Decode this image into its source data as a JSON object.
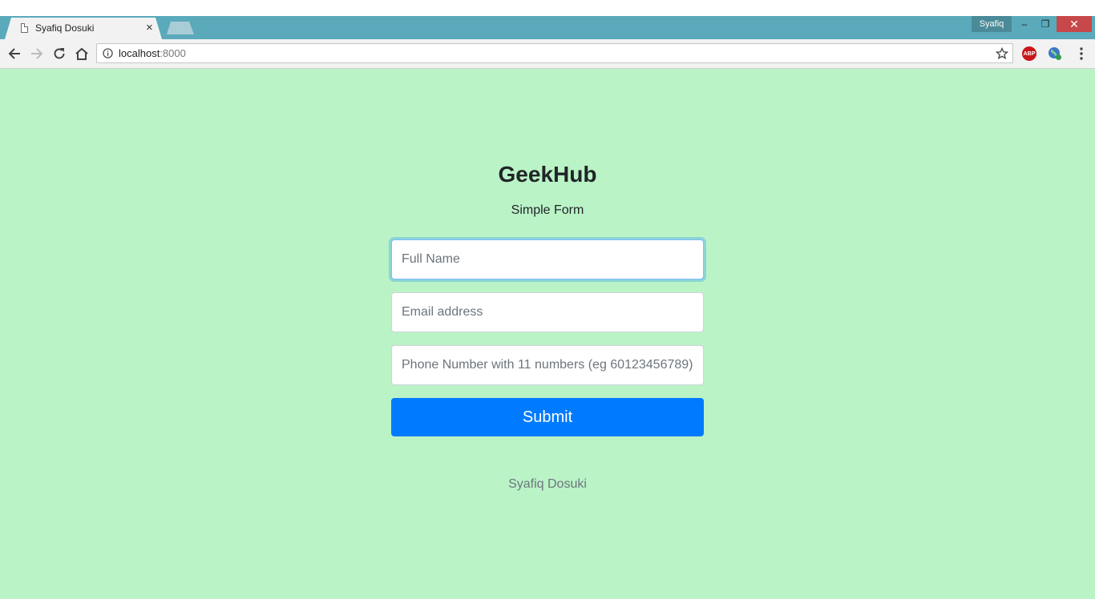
{
  "browser": {
    "tab_title": "Syafiq Dosuki",
    "tab_close": "×",
    "profile_name": "Syafiq",
    "url_host": "localhost",
    "url_port": ":8000",
    "window_controls": {
      "minimize": "–",
      "maximize": "❐",
      "close": "✕"
    },
    "extensions": {
      "adblock_label": "ABP"
    }
  },
  "page": {
    "title": "GeekHub",
    "subtitle": "Simple Form",
    "form": {
      "name_placeholder": "Full Name",
      "email_placeholder": "Email address",
      "phone_placeholder": "Phone Number with 11 numbers (eg 60123456789)",
      "submit_label": "Submit"
    },
    "footer": "Syafiq Dosuki"
  },
  "colors": {
    "page_background": "#baf3c6",
    "titlebar": "#5aaabb",
    "primary_button": "#007bff",
    "close_button": "#c7484a"
  }
}
